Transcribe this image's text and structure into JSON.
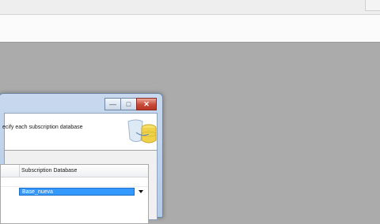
{
  "dialog": {
    "instruction": "ecify each subscription database",
    "title_buttons": {
      "minimize": "—",
      "maximize": "□",
      "close": "✕"
    }
  },
  "grid": {
    "columns": [
      "Subscription Database"
    ],
    "rows": [
      {
        "subscription_database": "Base_nueva"
      }
    ]
  },
  "icons": [
    "minimize-icon",
    "maximize-icon",
    "close-icon",
    "database-icon",
    "chevron-down-icon"
  ]
}
